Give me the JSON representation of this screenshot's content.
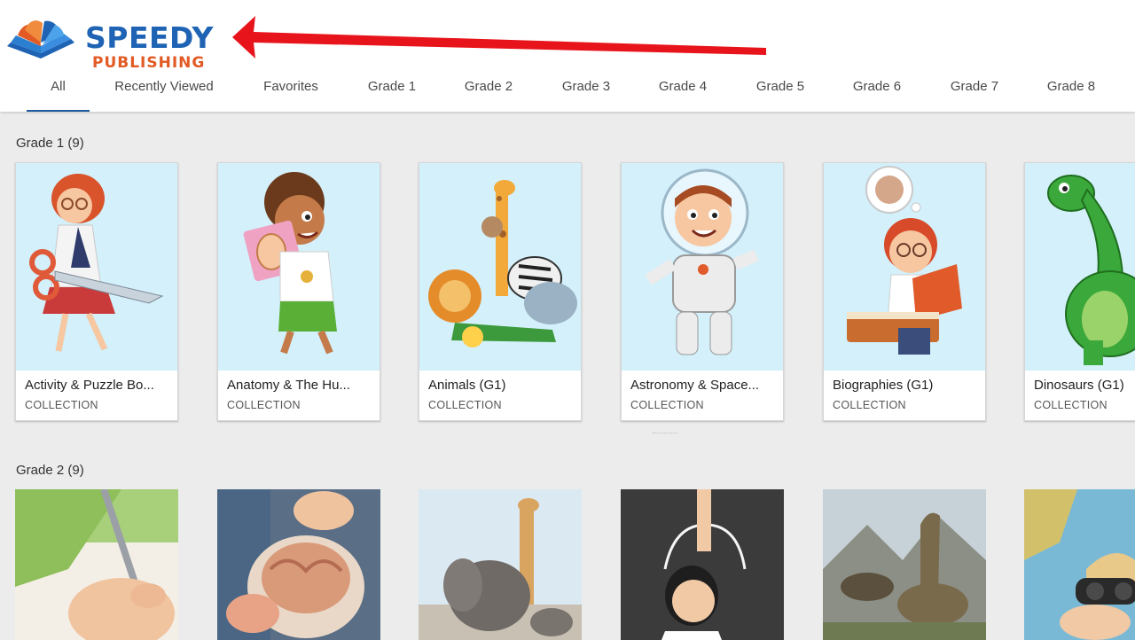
{
  "brand": {
    "name_top": "SPEEDY",
    "name_bottom": "PUBLISHING"
  },
  "colors": {
    "brand_blue": "#1f63b4",
    "brand_orange": "#e25a24",
    "tab_underline": "#1b5a9c",
    "annotation_arrow": "#e8141b",
    "thumb_bg": "#d3f0fb"
  },
  "tabs": [
    {
      "label": "All",
      "active": true
    },
    {
      "label": "Recently Viewed"
    },
    {
      "label": "Favorites"
    },
    {
      "label": "Grade 1"
    },
    {
      "label": "Grade 2"
    },
    {
      "label": "Grade 3"
    },
    {
      "label": "Grade 4"
    },
    {
      "label": "Grade 5"
    },
    {
      "label": "Grade 6"
    },
    {
      "label": "Grade 7"
    },
    {
      "label": "Grade 8"
    }
  ],
  "sections": [
    {
      "title": "Grade 1 (9)",
      "cards": [
        {
          "title": "Activity & Puzzle Bo...",
          "type": "COLLECTION",
          "icon": "girl-with-scissors-illustration"
        },
        {
          "title": "Anatomy & The Hu...",
          "type": "COLLECTION",
          "icon": "boy-with-ear-card-illustration"
        },
        {
          "title": "Animals (G1)",
          "type": "COLLECTION",
          "icon": "animals-group-illustration"
        },
        {
          "title": "Astronomy & Space...",
          "type": "COLLECTION",
          "icon": "astronaut-boy-illustration"
        },
        {
          "title": "Biographies (G1)",
          "type": "COLLECTION",
          "icon": "boy-reading-book-illustration"
        },
        {
          "title": "Dinosaurs (G1)",
          "type": "COLLECTION",
          "icon": "green-dinosaur-illustration"
        }
      ]
    },
    {
      "title": "Grade 2 (9)",
      "cards": [
        {
          "icon": "child-writing-photo"
        },
        {
          "icon": "brain-model-photo"
        },
        {
          "icon": "elephant-giraffe-photo"
        },
        {
          "icon": "girl-chalkboard-photo"
        },
        {
          "icon": "dinosaurs-landscape-photo"
        },
        {
          "icon": "child-binoculars-photo"
        }
      ]
    }
  ]
}
